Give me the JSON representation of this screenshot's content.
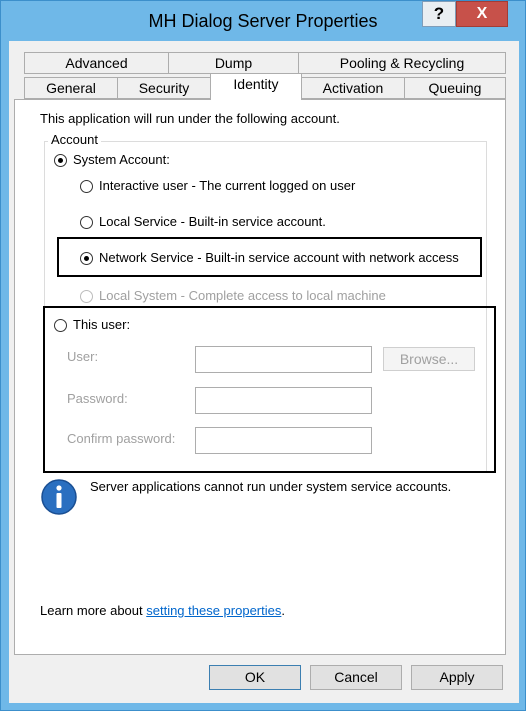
{
  "window": {
    "title": "MH Dialog Server Properties",
    "help_label": "?",
    "close_label": "X"
  },
  "tabs": {
    "row1": [
      "Advanced",
      "Dump",
      "Pooling & Recycling"
    ],
    "row2": [
      "General",
      "Security",
      "Identity",
      "Activation",
      "Queuing"
    ],
    "active": "Identity"
  },
  "identity": {
    "intro": "This application will run under the following account.",
    "group_label": "Account",
    "system_account": "System Account:",
    "options": [
      "Interactive user - The current logged on user",
      "Local Service - Built-in service account.",
      "Network Service - Built-in service account with network access",
      "Local System - Complete access to local machine"
    ],
    "selected_option": "Network Service - Built-in service account with network access",
    "this_user": "This user:",
    "user_label": "User:",
    "password_label": "Password:",
    "confirm_label": "Confirm password:",
    "user_value": "",
    "password_value": "",
    "confirm_value": "",
    "browse_label": "Browse...",
    "info_text": "Server applications cannot run under system service accounts.",
    "learn_prefix": "Learn more about ",
    "learn_link": "setting these properties",
    "learn_suffix": "."
  },
  "buttons": {
    "ok": "OK",
    "cancel": "Cancel",
    "apply": "Apply"
  },
  "colors": {
    "titlebar": "#6fb8e8",
    "close": "#c7514a",
    "link": "#0066cc",
    "info_icon": "#2a6fc0"
  }
}
